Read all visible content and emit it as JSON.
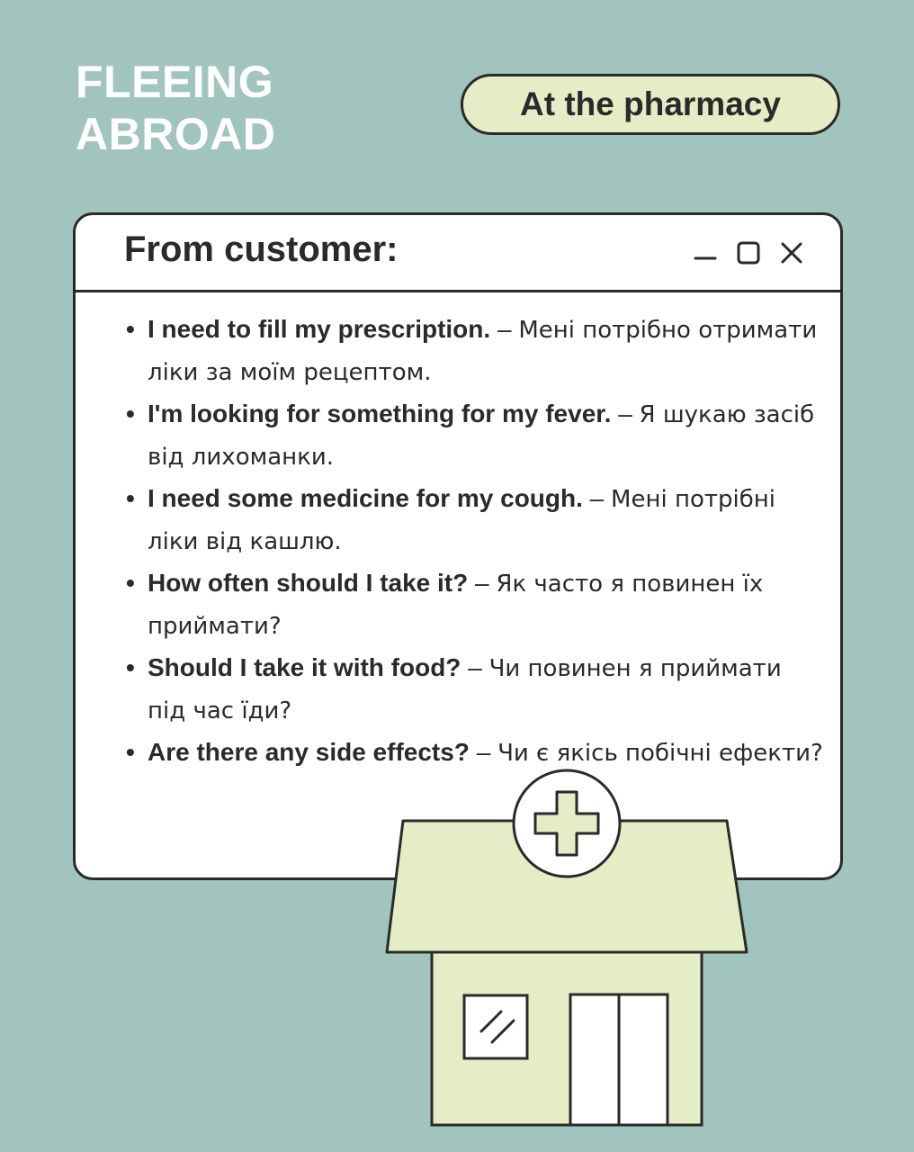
{
  "brand": {
    "line1": "FLEEING",
    "line2": "ABROAD"
  },
  "topic": "At the pharmacy",
  "window": {
    "title": "From customer:",
    "controls": [
      "minimize-icon",
      "maximize-icon",
      "close-icon"
    ]
  },
  "phrases": [
    {
      "en": "I need to fill my prescription.",
      "ua": "Мені потрібно отримати ліки за моїм рецептом."
    },
    {
      "en": "I'm looking for something for my fever.",
      "ua": "Я шукаю засіб від лихоманки."
    },
    {
      "en": "I need some medicine for my cough.",
      "ua": "Мені потрібні ліки від кашлю."
    },
    {
      "en": "How often should I take it?",
      "ua": "Як часто я повинен їх приймати?"
    },
    {
      "en": "Should I take it with food?",
      "ua": "Чи повинен я приймати під час їди?"
    },
    {
      "en": "Are there any side effects?",
      "ua": "Чи є якісь побічні ефекти?"
    }
  ],
  "colors": {
    "background": "#a2c4be",
    "pill": "#e4edc6",
    "building": "#e4edc6",
    "outline": "#2a2a2a"
  }
}
